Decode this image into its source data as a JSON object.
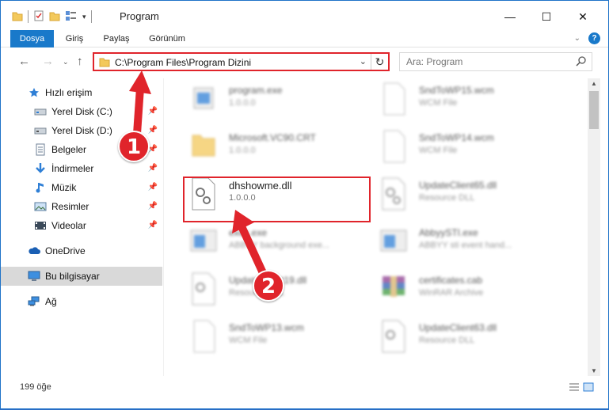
{
  "window": {
    "title": "Program",
    "controls": {
      "minimize": "—",
      "maximize": "☐",
      "close": "✕"
    }
  },
  "ribbon": {
    "tabs": [
      "Dosya",
      "Giriş",
      "Paylaş",
      "Görünüm"
    ]
  },
  "address": {
    "path": "C:\\Program Files\\Program Dizini",
    "search_placeholder": "Ara: Program"
  },
  "sidebar": {
    "items": [
      {
        "label": "Hızlı erişim",
        "icon": "star-icon",
        "pinned": false
      },
      {
        "label": "Yerel Disk (C:)",
        "icon": "disk-icon",
        "pinned": true
      },
      {
        "label": "Yerel Disk (D:)",
        "icon": "disk-icon",
        "pinned": true
      },
      {
        "label": "Belgeler",
        "icon": "documents-icon",
        "pinned": true
      },
      {
        "label": "İndirmeler",
        "icon": "download-icon",
        "pinned": true
      },
      {
        "label": "Müzik",
        "icon": "music-icon",
        "pinned": true
      },
      {
        "label": "Resimler",
        "icon": "pictures-icon",
        "pinned": true
      },
      {
        "label": "Videolar",
        "icon": "videos-icon",
        "pinned": true
      },
      {
        "label": "OneDrive",
        "icon": "cloud-icon",
        "pinned": false
      },
      {
        "label": "Bu bilgisayar",
        "icon": "computer-icon",
        "pinned": false,
        "selected": true
      },
      {
        "label": "Ağ",
        "icon": "network-icon",
        "pinned": false
      }
    ]
  },
  "files": [
    {
      "name": "program.exe",
      "meta": "1.0.0.0",
      "icon": "exe-icon",
      "blurred": true
    },
    {
      "name": "SndToWP15.wcm",
      "meta": "WCM File",
      "icon": "file-icon",
      "blurred": true
    },
    {
      "name": "Microsoft.VC90.CRT",
      "meta": "1.0.0.0",
      "icon": "folder-icon",
      "blurred": true
    },
    {
      "name": "SndToWP14.wcm",
      "meta": "WCM File",
      "icon": "file-icon",
      "blurred": true
    },
    {
      "name": "dhshowme.dll",
      "meta": "1.0.0.0",
      "icon": "dll-icon",
      "blurred": false
    },
    {
      "name": "UpdateClient65.dll",
      "meta": "Resource DLL",
      "icon": "dll-icon",
      "blurred": true
    },
    {
      "name": "exec.exe",
      "meta": "ABBYY background exe...",
      "icon": "window-icon",
      "blurred": true
    },
    {
      "name": "AbbyySTI.exe",
      "meta": "ABBYY sti event hand...",
      "icon": "window-icon",
      "blurred": true
    },
    {
      "name": "UpdateClient19.dll",
      "meta": "Resource DLL",
      "icon": "dll-icon",
      "blurred": true
    },
    {
      "name": "certificates.cab",
      "meta": "WinRAR Archive",
      "icon": "archive-icon",
      "blurred": true
    },
    {
      "name": "SndToWP13.wcm",
      "meta": "WCM File",
      "icon": "file-icon",
      "blurred": true
    },
    {
      "name": "UpdateClient63.dll",
      "meta": "Resource DLL",
      "icon": "dll-icon",
      "blurred": true
    }
  ],
  "status": {
    "count": "199 öğe"
  },
  "annotations": {
    "step1": "1",
    "step2": "2"
  },
  "colors": {
    "accent": "#1979ca",
    "annotation_red": "#e0242b"
  }
}
